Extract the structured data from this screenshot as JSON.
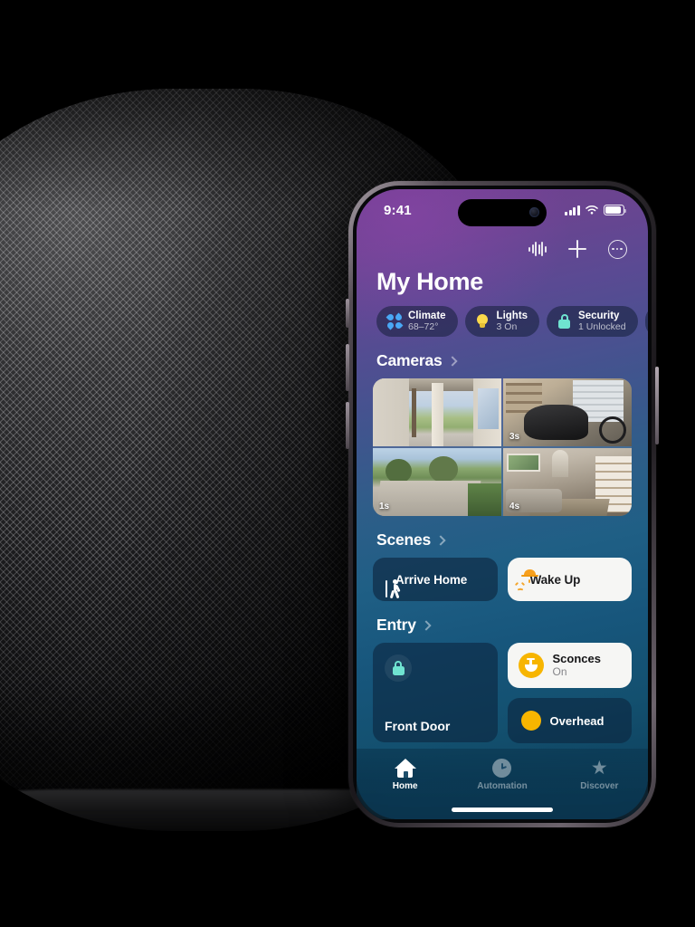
{
  "scene": {
    "device_left": "homepod-speaker",
    "device_right": "iphone"
  },
  "phone": {
    "status_bar": {
      "time": "9:41",
      "cellular_icon": "cellular-bars-icon",
      "wifi_icon": "wifi-icon",
      "battery_icon": "battery-icon"
    },
    "toolbar": {
      "media_icon": "audio-waveform-icon",
      "add_icon": "plus-icon",
      "more_icon": "ellipsis-circle-icon"
    },
    "title": "My Home",
    "categories": [
      {
        "icon": "fan-icon",
        "label": "Climate",
        "status": "68–72°"
      },
      {
        "icon": "lightbulb-icon",
        "label": "Lights",
        "status": "3 On"
      },
      {
        "icon": "lock-icon",
        "label": "Security",
        "status": "1 Unlocked"
      },
      {
        "icon": "speaker-icon",
        "label": "",
        "status": ""
      }
    ],
    "sections": {
      "cameras": {
        "title": "Cameras",
        "chevron": "chevron-right-icon",
        "tiles": [
          {
            "name": "front-porch-camera",
            "timestamp": ""
          },
          {
            "name": "garage-camera",
            "timestamp": "3s"
          },
          {
            "name": "driveway-camera",
            "timestamp": "1s"
          },
          {
            "name": "living-room-camera",
            "timestamp": "4s"
          }
        ]
      },
      "scenes": {
        "title": "Scenes",
        "chevron": "chevron-right-icon",
        "tiles": [
          {
            "label": "Arrive Home",
            "icon": "walking-person-icon",
            "active": false
          },
          {
            "label": "Wake Up",
            "icon": "sunrise-icon",
            "active": true
          }
        ]
      },
      "entry": {
        "title": "Entry",
        "chevron": "chevron-right-icon",
        "lock_tile": {
          "label": "Front Door",
          "icon": "lock-icon"
        },
        "accessories": [
          {
            "label": "Sconces",
            "status": "On",
            "icon": "sconce-light-icon",
            "active": true
          },
          {
            "label": "Overhead",
            "status": "",
            "icon": "light-dot-icon",
            "active": false
          }
        ]
      }
    },
    "tabbar": [
      {
        "label": "Home",
        "icon": "house-icon",
        "selected": true
      },
      {
        "label": "Automation",
        "icon": "clock-icon",
        "selected": false
      },
      {
        "label": "Discover",
        "icon": "star-icon",
        "selected": false
      }
    ]
  },
  "colors": {
    "accent_yellow": "#f7b500",
    "accent_teal": "#6fe3d0",
    "accent_blue": "#49a8f5",
    "accent_orange": "#f7a01e",
    "tile_light": "#f6f6f4"
  }
}
